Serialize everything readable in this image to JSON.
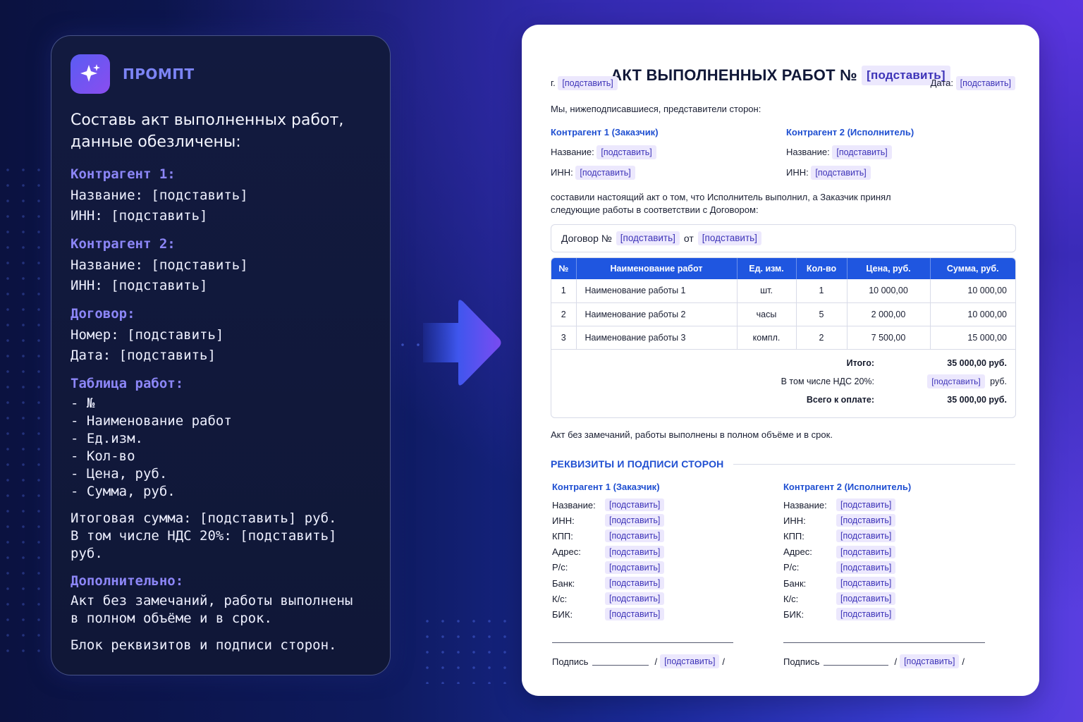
{
  "prompt": {
    "header": "ПРОМПТ",
    "lead_1": "Составь акт выполненных работ,",
    "lead_2": "данные обезличены:",
    "sections": {
      "c1_title": "Контрагент 1:",
      "c1_name": "Название: [подставить]",
      "c1_inn": "ИНН: [подставить]",
      "c2_title": "Контрагент 2:",
      "c2_name": "Название: [подставить]",
      "c2_inn": "ИНН: [подставить]",
      "contract_title": "Договор:",
      "contract_number": "Номер: [подставить]",
      "contract_date": "Дата: [подставить]",
      "table_title": "Таблица работ:",
      "table_items": [
        "- №",
        "- Наименование работ",
        "- Ед.изм.",
        "- Кол-во",
        "- Цена, руб.",
        "- Сумма, руб."
      ],
      "total_line": "Итоговая сумма: [подставить] руб.",
      "vat_line": "В том числе НДС 20%: [подставить] руб.",
      "extra_title": "Дополнительно:",
      "extra_1": "Акт без замечаний, работы выполнены",
      "extra_2": "в полном объёме и в срок.",
      "extra_3": "Блок реквизитов и подписи сторон."
    }
  },
  "doc": {
    "title": "АКТ ВЫПОЛНЕННЫХ РАБОТ №",
    "ph": "[подставить]",
    "city_label": "г.",
    "date_label": "Дата:",
    "intro": "Мы, нижеподписавшиеся, представители сторон:",
    "party1_title": "Контрагент 1 (Заказчик)",
    "party2_title": "Контрагент 2 (Исполнитель)",
    "name_label": "Название:",
    "inn_label": "ИНН:",
    "statement_1": "составили настоящий акт о том, что Исполнитель выполнил, а Заказчик принял",
    "statement_2": "следующие работы в соответствии с Договором:",
    "contract_label": "Договор №",
    "from_label": "от",
    "table": {
      "headers": [
        "№",
        "Наименование работ",
        "Ед. изм.",
        "Кол-во",
        "Цена, руб.",
        "Сумма, руб."
      ],
      "rows": [
        [
          "1",
          "Наименование работы 1",
          "шт.",
          "1",
          "10 000,00",
          "10 000,00"
        ],
        [
          "2",
          "Наименование работы 2",
          "часы",
          "5",
          "2 000,00",
          "10 000,00"
        ],
        [
          "3",
          "Наименование работы 3",
          "компл.",
          "2",
          "7 500,00",
          "15 000,00"
        ]
      ]
    },
    "totals": {
      "total_label": "Итого:",
      "total_value": "35 000,00 руб.",
      "vat_label": "В том числе НДС 20%:",
      "vat_suffix": "руб.",
      "pay_label": "Всего к оплате:",
      "pay_value": "35 000,00 руб."
    },
    "remark": "Акт без замечаний, работы выполнены в полном объёме и в срок.",
    "requisites_title": "РЕКВИЗИТЫ И ПОДПИСИ СТОРОН",
    "req_party1": "Контрагент 1 (Заказчик)",
    "req_party2": "Контрагент 2 (Исполнитель)",
    "req_labels": [
      "Название:",
      "ИНН:",
      "КПП:",
      "Адрес:",
      "Р/с:",
      "Банк:",
      "К/с:",
      "БИК:"
    ],
    "signature_label": "Подпись",
    "slash": "/"
  }
}
